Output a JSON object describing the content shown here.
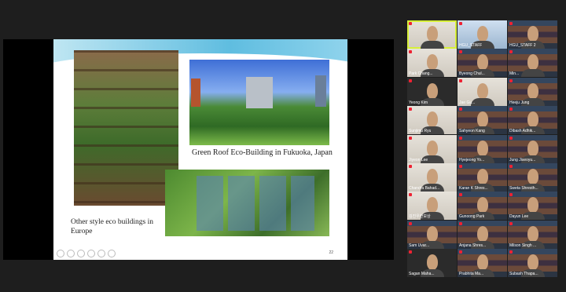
{
  "slide": {
    "caption_top": "Green Roof Eco-Building in Fukuoka, Japan",
    "caption_left": "Other style eco buildings in Europe",
    "page_number": "22"
  },
  "participants": [
    {
      "name": "",
      "bg": "t-room"
    },
    {
      "name": "HGU_STAFF",
      "bg": "t-blue"
    },
    {
      "name": "HGU_STAFF 2",
      "bg": "t-shelf"
    },
    {
      "name": "Park Chang...",
      "bg": "t-room"
    },
    {
      "name": "Byeong Chul...",
      "bg": "t-shelf"
    },
    {
      "name": "Min...",
      "bg": "t-shelf"
    },
    {
      "name": "Yeong Kim",
      "bg": "t-dark"
    },
    {
      "name": "Jae Gu...",
      "bg": "t-room"
    },
    {
      "name": "Heeju Jung",
      "bg": "t-shelf"
    },
    {
      "name": "Sunjimu Ryu",
      "bg": "t-room"
    },
    {
      "name": "Sahyeon Kang",
      "bg": "t-shelf"
    },
    {
      "name": "Dibash Adhik...",
      "bg": "t-shelf"
    },
    {
      "name": "Jiyeon Lee",
      "bg": "t-room"
    },
    {
      "name": "Hyejeong Yo...",
      "bg": "t-shelf"
    },
    {
      "name": "Jung Jiseoyu...",
      "bg": "t-shelf"
    },
    {
      "name": "Chandra Bahad...",
      "bg": "t-room"
    },
    {
      "name": "Karan K Shres...",
      "bg": "t-shelf"
    },
    {
      "name": "Sweta Shresth...",
      "bg": "t-shelf"
    },
    {
      "name": "김진우한보상",
      "bg": "t-room"
    },
    {
      "name": "Gunoong Park",
      "bg": "t-shelf"
    },
    {
      "name": "Dayun Lee",
      "bg": "t-shelf"
    },
    {
      "name": "Sam Uvar...",
      "bg": "t-shelf"
    },
    {
      "name": "Anjana Shres...",
      "bg": "t-shelf"
    },
    {
      "name": "Milson Singh ...",
      "bg": "t-shelf"
    },
    {
      "name": "Sagan Maha...",
      "bg": "t-dark"
    },
    {
      "name": "Prabhita Ma...",
      "bg": "t-shelf"
    },
    {
      "name": "Subash Thapa...",
      "bg": "t-shelf"
    }
  ]
}
